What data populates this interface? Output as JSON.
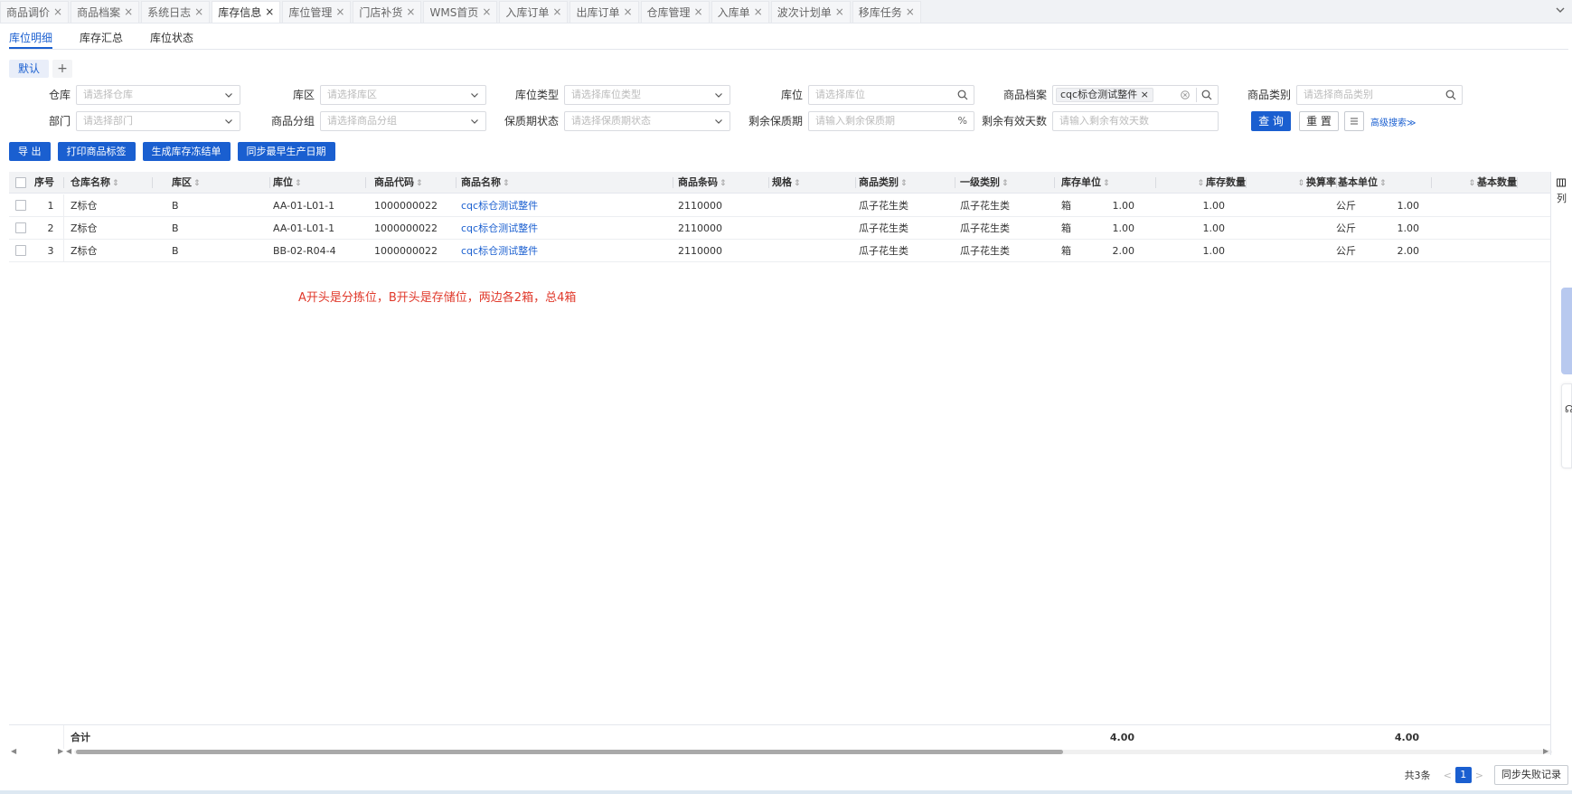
{
  "tabs": [
    {
      "label": "商品调价",
      "active": false
    },
    {
      "label": "商品档案",
      "active": false
    },
    {
      "label": "系统日志",
      "active": false
    },
    {
      "label": "库存信息",
      "active": true
    },
    {
      "label": "库位管理",
      "active": false
    },
    {
      "label": "门店补货",
      "active": false
    },
    {
      "label": "WMS首页",
      "active": false
    },
    {
      "label": "入库订单",
      "active": false
    },
    {
      "label": "出库订单",
      "active": false
    },
    {
      "label": "仓库管理",
      "active": false
    },
    {
      "label": "入库单",
      "active": false
    },
    {
      "label": "波次计划单",
      "active": false
    },
    {
      "label": "移库任务",
      "active": false
    }
  ],
  "subtabs": [
    {
      "label": "库位明细",
      "active": true
    },
    {
      "label": "库存汇总",
      "active": false
    },
    {
      "label": "库位状态",
      "active": false
    }
  ],
  "scheme": {
    "default_label": "默认",
    "add_label": "+"
  },
  "filters": {
    "warehouse": {
      "label": "仓库",
      "placeholder": "请选择仓库"
    },
    "zone": {
      "label": "库区",
      "placeholder": "请选择库区"
    },
    "location_type": {
      "label": "库位类型",
      "placeholder": "请选择库位类型"
    },
    "location": {
      "label": "库位",
      "placeholder": "请选择库位"
    },
    "product_file": {
      "label": "商品档案",
      "value": "cqc标仓测试整件"
    },
    "product_category": {
      "label": "商品类别",
      "placeholder": "请选择商品类别"
    },
    "department": {
      "label": "部门",
      "placeholder": "请选择部门"
    },
    "product_group": {
      "label": "商品分组",
      "placeholder": "请选择商品分组"
    },
    "shelf_status": {
      "label": "保质期状态",
      "placeholder": "请选择保质期状态"
    },
    "remaining_shelf": {
      "label": "剩余保质期",
      "placeholder": "请输入剩余保质期",
      "suffix": "%"
    },
    "remaining_days": {
      "label": "剩余有效天数",
      "placeholder": "请输入剩余有效天数"
    }
  },
  "buttons": {
    "query": "查 询",
    "reset": "重 置",
    "advanced": "高级搜索≫"
  },
  "actions": [
    "导 出",
    "打印商品标签",
    "生成库存冻结单",
    "同步最早生产日期"
  ],
  "columns": [
    "序号",
    "仓库名称",
    "库区",
    "库位",
    "商品代码",
    "商品名称",
    "商品条码",
    "规格",
    "商品类别",
    "一级类别",
    "库存单位",
    "库存数量",
    "换算率",
    "基本单位",
    "基本数量"
  ],
  "rows": [
    {
      "idx": "1",
      "warehouse": "Z标仓",
      "zone": "B",
      "location": "AA-01-L01-1",
      "code": "1000000022",
      "name": "cqc标仓测试整件",
      "barcode": "2110000",
      "spec": "",
      "category": "瓜子花生类",
      "level1": "瓜子花生类",
      "unit": "箱",
      "qty": "1.00",
      "rate": "1.00",
      "base_unit": "公斤",
      "base_qty": "1.00"
    },
    {
      "idx": "2",
      "warehouse": "Z标仓",
      "zone": "B",
      "location": "AA-01-L01-1",
      "code": "1000000022",
      "name": "cqc标仓测试整件",
      "barcode": "2110000",
      "spec": "",
      "category": "瓜子花生类",
      "level1": "瓜子花生类",
      "unit": "箱",
      "qty": "1.00",
      "rate": "1.00",
      "base_unit": "公斤",
      "base_qty": "1.00"
    },
    {
      "idx": "3",
      "warehouse": "Z标仓",
      "zone": "B",
      "location": "BB-02-R04-4",
      "code": "1000000022",
      "name": "cqc标仓测试整件",
      "barcode": "2110000",
      "spec": "",
      "category": "瓜子花生类",
      "level1": "瓜子花生类",
      "unit": "箱",
      "qty": "2.00",
      "rate": "1.00",
      "base_unit": "公斤",
      "base_qty": "2.00"
    }
  ],
  "note": "A开头是分拣位，B开头是存储位，两边各2箱，总4箱",
  "footer": {
    "label": "合计",
    "qty_total": "4.00",
    "base_qty_total": "4.00"
  },
  "right_panel": {
    "column_label": "列"
  },
  "pager": {
    "total": "共3条",
    "prev": "<",
    "page": "1",
    "next": ">",
    "sync_failed": "同步失败记录"
  }
}
